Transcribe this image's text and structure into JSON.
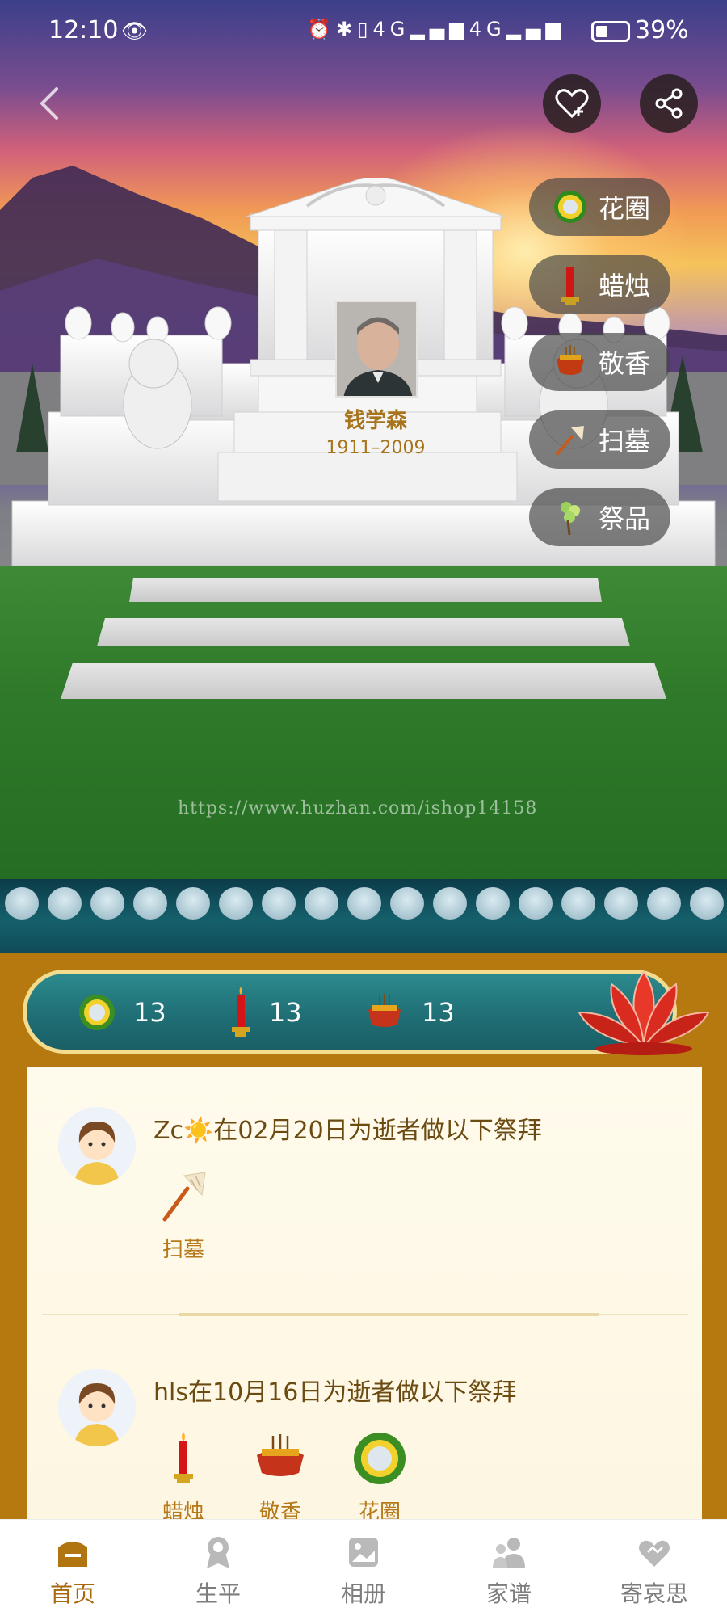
{
  "status_bar": {
    "time": "12:10",
    "battery": "39%",
    "battery_level": 0.39,
    "network": "4G"
  },
  "header": {
    "back_icon": "chevron-left-icon",
    "favorite_icon": "heart-plus-icon",
    "share_icon": "share-icon"
  },
  "actions": [
    {
      "label": "花圈",
      "icon": "wreath-icon"
    },
    {
      "label": "蜡烛",
      "icon": "candle-icon"
    },
    {
      "label": "敬香",
      "icon": "incense-icon"
    },
    {
      "label": "扫墓",
      "icon": "broom-icon"
    },
    {
      "label": "祭品",
      "icon": "offering-icon"
    }
  ],
  "deceased": {
    "name": "钱学森",
    "dates": "1911–2009"
  },
  "watermark": "https://www.huzhan.com/ishop14158",
  "counters": [
    {
      "icon": "wreath-icon",
      "count": "13"
    },
    {
      "icon": "candle-icon",
      "count": "13"
    },
    {
      "icon": "incense-icon",
      "count": "13"
    }
  ],
  "feed": [
    {
      "text": "Zc☀️在02月20日为逝者做以下祭拜",
      "offerings": [
        {
          "label": "扫墓",
          "icon": "broom-icon"
        }
      ]
    },
    {
      "text": "hls在10月16日为逝者做以下祭拜",
      "offerings": [
        {
          "label": "蜡烛",
          "icon": "candle-icon"
        },
        {
          "label": "敬香",
          "icon": "incense-icon"
        },
        {
          "label": "花圈",
          "icon": "wreath-icon"
        }
      ]
    }
  ],
  "nav": [
    {
      "label": "首页",
      "icon": "home-icon",
      "active": true
    },
    {
      "label": "生平",
      "icon": "badge-icon",
      "active": false
    },
    {
      "label": "相册",
      "icon": "album-icon",
      "active": false
    },
    {
      "label": "家谱",
      "icon": "family-icon",
      "active": false
    },
    {
      "label": "寄哀思",
      "icon": "heart-message-icon",
      "active": false
    }
  ],
  "colors": {
    "gold": "#b5790f",
    "teal": "#1f6d74",
    "text_brown": "#6b4b12",
    "active_nav": "#a7680d"
  }
}
